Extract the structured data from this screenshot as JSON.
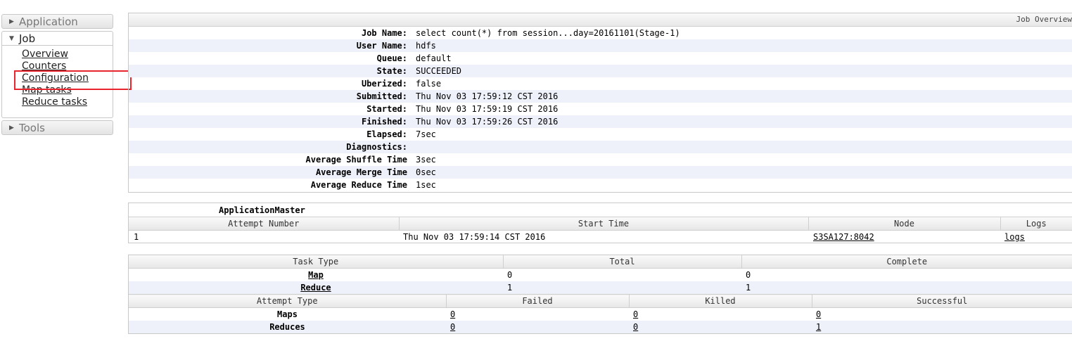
{
  "nav": {
    "application": "Application",
    "job": "Job",
    "tools": "Tools",
    "job_links": [
      "Overview",
      "Counters",
      "Configuration",
      "Map tasks",
      "Reduce tasks"
    ]
  },
  "overview": {
    "caption": "Job Overview",
    "rows": [
      {
        "label": "Job Name:",
        "value": "select count(*) from session...day=20161101(Stage-1)"
      },
      {
        "label": "User Name:",
        "value": "hdfs"
      },
      {
        "label": "Queue:",
        "value": "default"
      },
      {
        "label": "State:",
        "value": "SUCCEEDED"
      },
      {
        "label": "Uberized:",
        "value": "false"
      },
      {
        "label": "Submitted:",
        "value": "Thu Nov 03 17:59:12 CST 2016"
      },
      {
        "label": "Started:",
        "value": "Thu Nov 03 17:59:19 CST 2016"
      },
      {
        "label": "Finished:",
        "value": "Thu Nov 03 17:59:26 CST 2016"
      },
      {
        "label": "Elapsed:",
        "value": "7sec"
      },
      {
        "label": "Diagnostics:",
        "value": ""
      },
      {
        "label": "Average Shuffle Time",
        "value": "3sec"
      },
      {
        "label": "Average Merge Time",
        "value": "0sec"
      },
      {
        "label": "Average Reduce Time",
        "value": "1sec"
      }
    ]
  },
  "am": {
    "title": "ApplicationMaster",
    "headers": [
      "Attempt Number",
      "Start Time",
      "Node",
      "Logs"
    ],
    "row": {
      "attempt": "1",
      "start": "Thu Nov 03 17:59:14 CST 2016",
      "node": "S3SA127:8042",
      "logs": "logs"
    }
  },
  "tasks": {
    "headers": [
      "Task Type",
      "Total",
      "Complete"
    ],
    "rows": [
      {
        "type": "Map",
        "total": "0",
        "complete": "0"
      },
      {
        "type": "Reduce",
        "total": "1",
        "complete": "1"
      }
    ]
  },
  "attempts": {
    "headers": [
      "Attempt Type",
      "Failed",
      "Killed",
      "Successful"
    ],
    "rows": [
      {
        "type": "Maps",
        "failed": "0",
        "killed": "0",
        "successful": "0"
      },
      {
        "type": "Reduces",
        "failed": "0",
        "killed": "0",
        "successful": "1"
      }
    ]
  }
}
